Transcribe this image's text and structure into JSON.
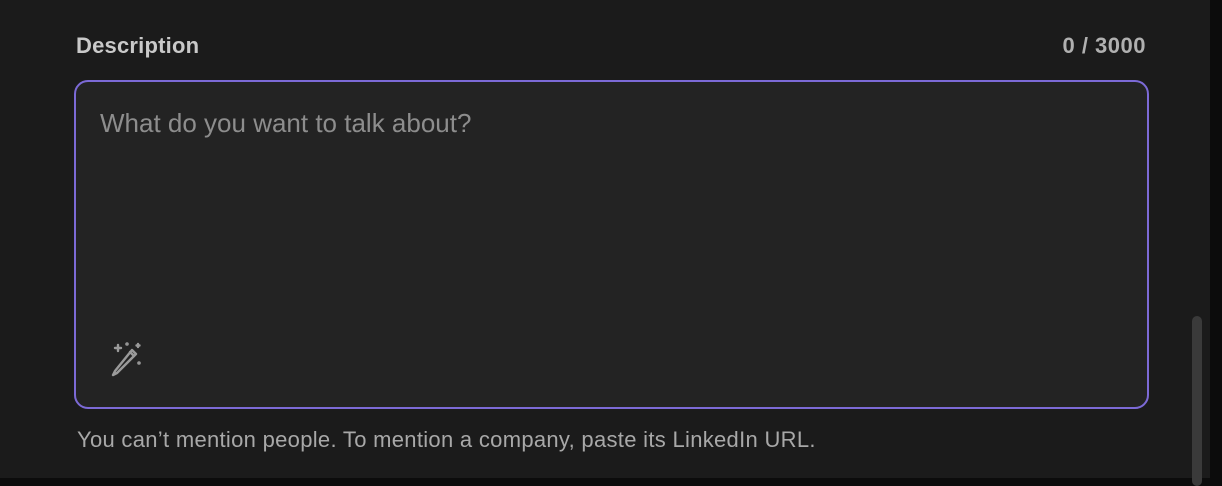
{
  "field": {
    "label": "Description",
    "counter": "0 / 3000",
    "placeholder": "What do you want to talk about?",
    "value": "",
    "helper": "You can’t mention people. To mention a company, paste its LinkedIn URL."
  },
  "icons": {
    "ai_assist": "magic-wand-pencil-icon"
  },
  "colors": {
    "focus_border": "#7c6ad6",
    "background": "#1b1b1b",
    "input_background": "#232323"
  }
}
